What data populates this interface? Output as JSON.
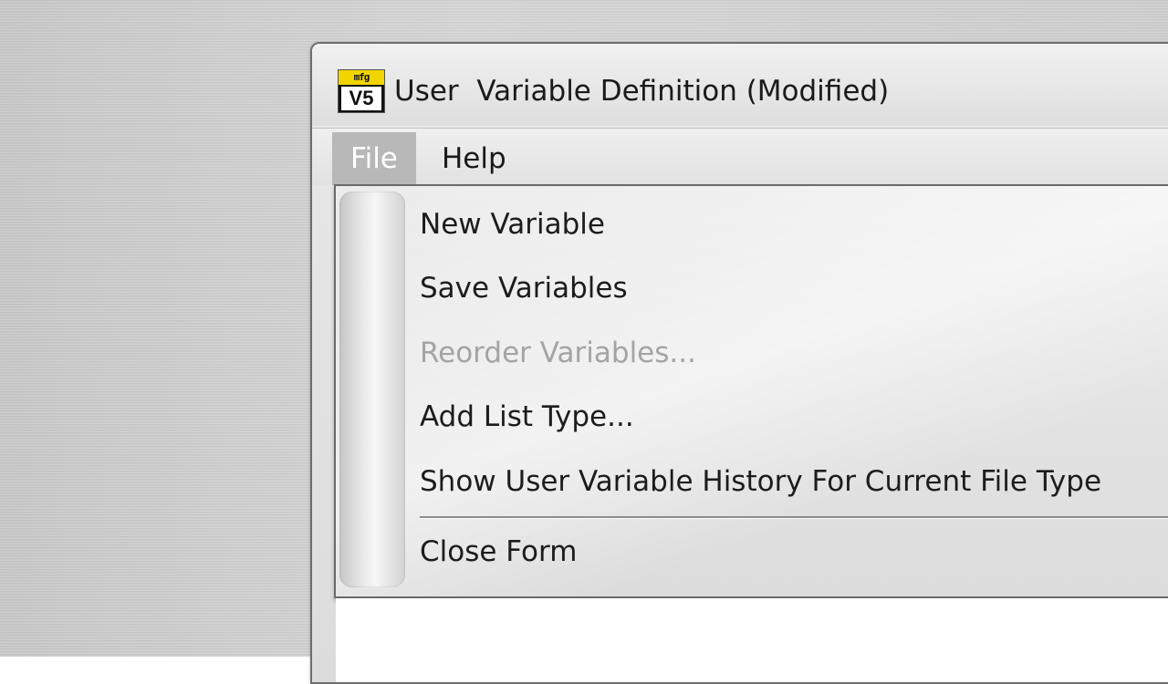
{
  "window": {
    "title": "User  Variable Definition (Modified)",
    "icon": {
      "name": "app-v5-icon",
      "top_text": "mfg",
      "bottom_text": "V5",
      "top_color": "#f2d500"
    }
  },
  "menubar": {
    "items": [
      {
        "label": "File",
        "active": true
      },
      {
        "label": "Help",
        "active": false
      }
    ]
  },
  "file_menu": {
    "items": [
      {
        "label": "New Variable",
        "enabled": true
      },
      {
        "label": "Save Variables",
        "enabled": true
      },
      {
        "label": "Reorder Variables...",
        "enabled": false
      },
      {
        "label": "Add List Type...",
        "enabled": true
      },
      {
        "label": "Show User Variable History For Current File Type",
        "enabled": true
      },
      {
        "label": "Close Form",
        "enabled": true
      }
    ]
  },
  "colors": {
    "menu_highlight": "#b8b8b8",
    "disabled_text": "#a4a4a4"
  }
}
